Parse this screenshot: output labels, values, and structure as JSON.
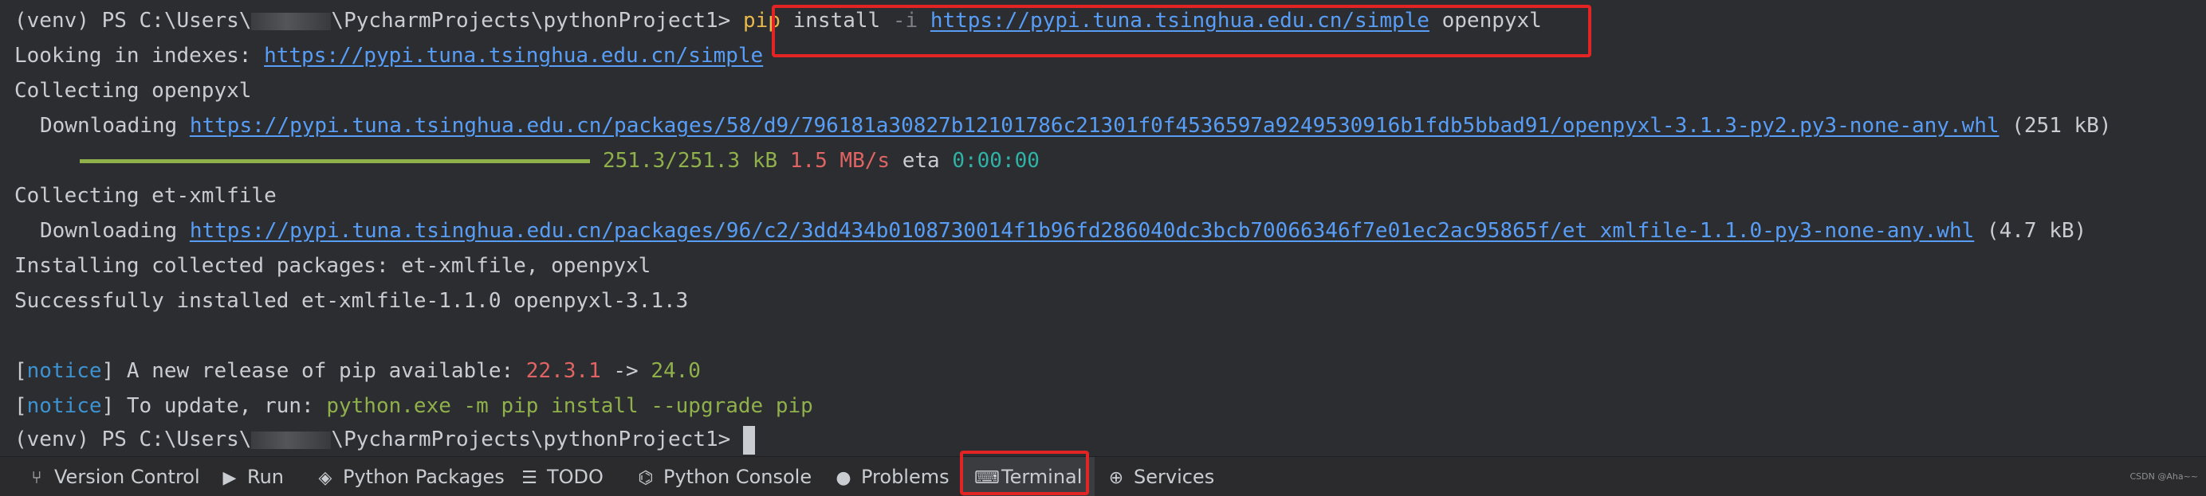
{
  "terminal": {
    "line1": {
      "prompt_pre": "(venv) PS C:\\Users\\",
      "prompt_post": "\\PycharmProjects\\pythonProject1> ",
      "cmd_pip": "pip",
      "cmd_install": " install ",
      "cmd_flag": "-i",
      "cmd_url": "https://pypi.tuna.tsinghua.edu.cn/simple",
      "cmd_pkg": " openpyxl"
    },
    "line2": {
      "text": "Looking in indexes: ",
      "url": "https://pypi.tuna.tsinghua.edu.cn/simple"
    },
    "line3": {
      "text": "Collecting openpyxl"
    },
    "line4": {
      "label": "Downloading ",
      "url": "https://pypi.tuna.tsinghua.edu.cn/packages/58/d9/796181a30827b12101786c21301f0f4536597a9249530916b1fdb5bbad91/openpyxl-3.1.3-py2.py3-none-any.whl",
      "size": " (251 kB)"
    },
    "line5": {
      "progress": 1.0,
      "amount": "251.3/251.3 kB",
      "speed": "1.5 MB/s",
      "eta_label": "eta",
      "eta": "0:00:00"
    },
    "line6": {
      "text": "Collecting et-xmlfile"
    },
    "line7": {
      "label": "Downloading ",
      "url": "https://pypi.tuna.tsinghua.edu.cn/packages/96/c2/3dd434b0108730014f1b96fd286040dc3bcb70066346f7e01ec2ac95865f/et_xmlfile-1.1.0-py3-none-any.whl",
      "size": " (4.7 kB)"
    },
    "line8": {
      "text": "Installing collected packages: et-xmlfile, openpyxl"
    },
    "line9": {
      "text": "Successfully installed et-xmlfile-1.1.0 openpyxl-3.1.3"
    },
    "line10": {
      "open": "[",
      "tag": "notice",
      "close": "]",
      "text": " A new release of pip available: ",
      "old": "22.3.1",
      "arrow": " -> ",
      "new": "24.0"
    },
    "line11": {
      "open": "[",
      "tag": "notice",
      "close": "]",
      "text": " To update, run: ",
      "cmd": "python.exe -m pip install --upgrade pip"
    },
    "line12": {
      "prompt_pre": "(venv) PS C:\\Users\\",
      "prompt_post": "\\PycharmProjects\\pythonProject1> "
    }
  },
  "statusbar": {
    "tabs": [
      {
        "label": "Version Control",
        "icon": "branch-icon"
      },
      {
        "label": "Run",
        "icon": "play-icon"
      },
      {
        "label": "Python Packages",
        "icon": "layers-icon"
      },
      {
        "label": "TODO",
        "icon": "list-icon"
      },
      {
        "label": "Python Console",
        "icon": "python-icon"
      },
      {
        "label": "Problems",
        "icon": "warning-icon"
      },
      {
        "label": "Terminal",
        "icon": "terminal-icon",
        "active": true
      },
      {
        "label": "Services",
        "icon": "services-icon"
      }
    ],
    "watermark": "CSDN @Aha~~"
  },
  "colors": {
    "background": "#2b2d30",
    "highlight": "#e32424",
    "link": "#589df6",
    "success": "#8fb04a",
    "error": "#e06464"
  }
}
